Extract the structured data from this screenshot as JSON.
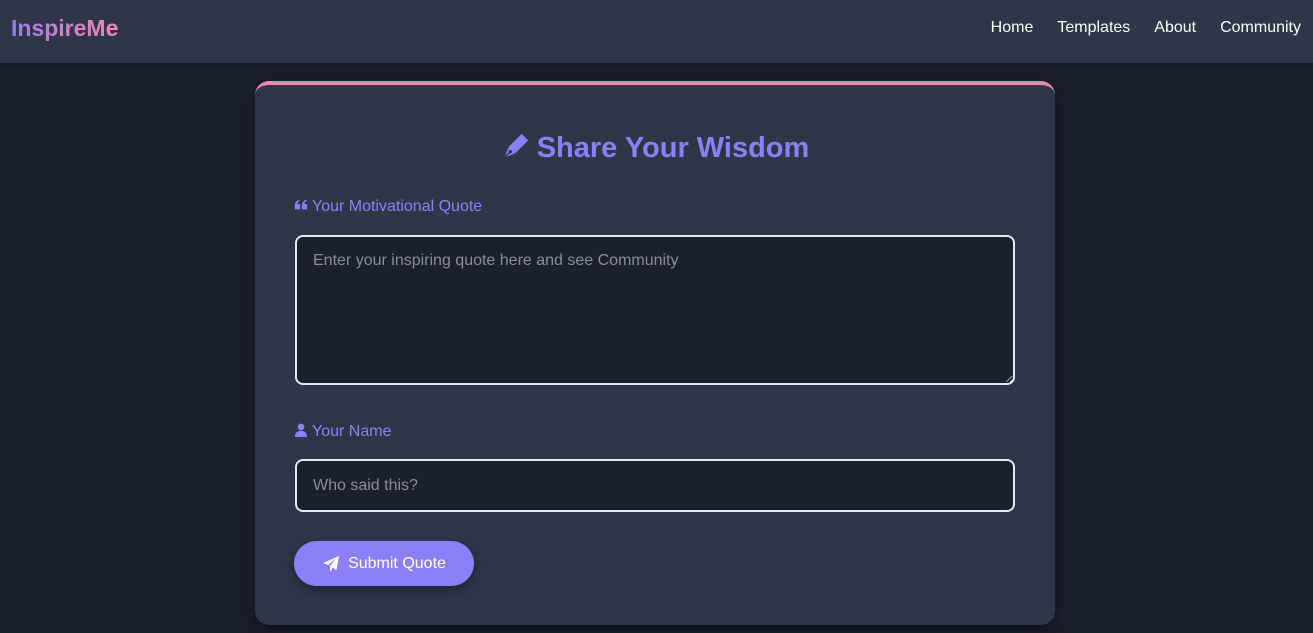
{
  "app": {
    "brand": "InspireMe"
  },
  "nav": {
    "items": [
      {
        "label": "Home"
      },
      {
        "label": "Templates"
      },
      {
        "label": "About"
      },
      {
        "label": "Community"
      }
    ]
  },
  "form": {
    "title": "Share Your Wisdom",
    "title_icon": "pen-nib-icon",
    "quote_label": "Your Motivational Quote",
    "quote_icon": "quote-left-icon",
    "quote_value": "",
    "quote_placeholder": "Enter your inspiring quote here and see Community",
    "name_label": "Your Name",
    "name_icon": "user-icon",
    "name_value": "",
    "name_placeholder": "Who said this?",
    "submit_label": "Submit Quote",
    "submit_icon": "paper-plane-icon"
  },
  "colors": {
    "background": "#1a202c",
    "surface": "#2d3748",
    "accent": "#8b80f9",
    "brand_gradient_start": "#9f7aea",
    "brand_gradient_end": "#f687b3",
    "card_top_border": "#f687b3"
  }
}
